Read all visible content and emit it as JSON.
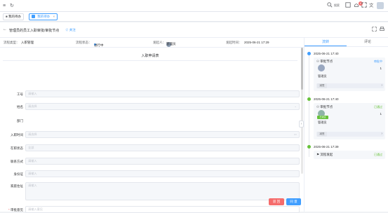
{
  "topbar": {
    "menu_icon": "≡",
    "refresh_icon": "↻",
    "search_label": "搜索",
    "notification_count": "4",
    "accent": "#409eff"
  },
  "tabs": [
    {
      "label": "我的待办",
      "active": false
    },
    {
      "label": "我的待办",
      "active": true
    }
  ],
  "header": {
    "back": "←",
    "title": "管理员的员工入职审批/审批节点",
    "follow": "☆ 关注"
  },
  "info": {
    "flow_type_label": "流程类型：",
    "flow_type_value": "入职管理",
    "flow_status_label": "流程状态：",
    "flow_status_value": "进行中",
    "initiator_label": "发起人：",
    "initiator_value": "管理员",
    "start_time_label": "发起时间：",
    "start_time_value": "2025-06-21 17:29"
  },
  "form": {
    "title": "入职申请表",
    "fields": [
      {
        "label": "工号",
        "placeholder": "请输入",
        "required": false
      },
      {
        "label": "姓名",
        "placeholder": "请选择",
        "required": false
      },
      {
        "label": "部门",
        "placeholder": "",
        "required": false
      },
      {
        "label": "入职时间",
        "placeholder": "请选择",
        "required": false
      },
      {
        "label": "在职状态",
        "placeholder": "全部",
        "required": false
      },
      {
        "label": "联系方式",
        "placeholder": "请输入",
        "required": false
      },
      {
        "label": "身份证",
        "placeholder": "请输入",
        "required": false
      },
      {
        "label": "家庭住址",
        "placeholder": "请输入",
        "required": false
      }
    ],
    "opinion_label": "审批意见",
    "opinion_placeholder": "请输入意见"
  },
  "buttons": {
    "reject": "驳 回",
    "approve": "同 意",
    "reject_color": "#f56c6c",
    "approve_color": "#409eff"
  },
  "right_tabs": [
    "流转",
    "评论"
  ],
  "timeline": [
    {
      "time": "2025-06-21 17:40",
      "node": "审批节点",
      "status": "审批中",
      "status_color": "#409eff",
      "person": "管理员",
      "count": "1",
      "sub_label": "减签",
      "dot_color": "#409eff"
    },
    {
      "time": "2025-06-21 17:40",
      "node": "审批节点",
      "status": "已通过",
      "status_color": "#67c23a",
      "person": "管理员",
      "count": "1",
      "sub_label": "减签",
      "tag": "已通过",
      "dot_color": "#67c23a"
    },
    {
      "time": "2025-06-21 17:39",
      "node": "流程发起",
      "status": "已通过",
      "status_color": "#67c23a",
      "dot_color": "#67c23a"
    }
  ]
}
